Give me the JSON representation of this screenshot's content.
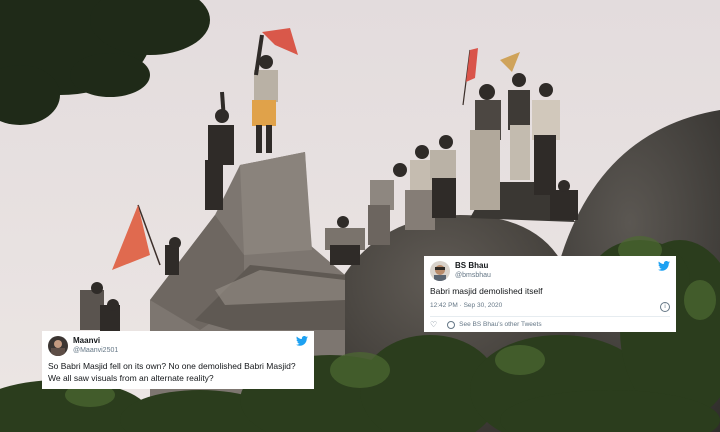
{
  "tweets": [
    {
      "name": "Maanvi",
      "handle": "@Maanvi2501",
      "text": "So Babri Masjid fell on its own? No one demolished Babri Masjid? We all saw visuals from an alternate reality?",
      "icon": "twitter-bird-icon"
    },
    {
      "name": "BS Bhau",
      "handle": "@bmsbhau",
      "text": "Babri masjid demolished itself",
      "timestamp": "12:42 PM · Sep 30, 2020",
      "other_tweets": "See BS Bhau's other Tweets",
      "icon": "twitter-bird-icon"
    }
  ],
  "colors": {
    "sky": "#e8e2e2",
    "twitter_blue": "#1da1f2",
    "flag": "#e0614a"
  }
}
